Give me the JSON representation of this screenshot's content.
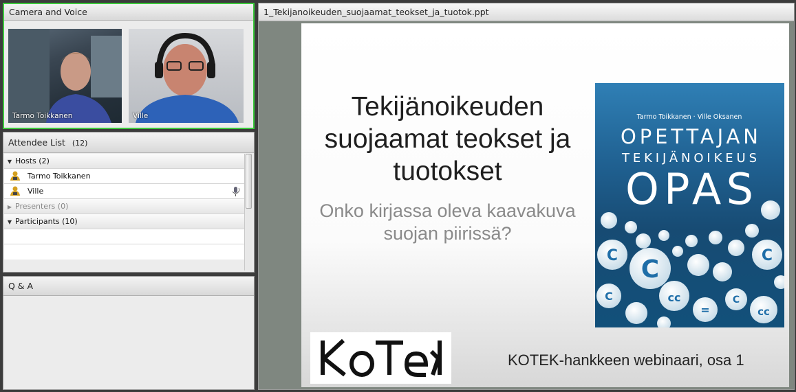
{
  "camera_pod": {
    "title": "Camera and Voice",
    "videos": [
      {
        "name": "Tarmo Toikkanen"
      },
      {
        "name": "Ville"
      }
    ]
  },
  "attendee_pod": {
    "title": "Attendee List",
    "count": "(12)",
    "hosts_group": "Hosts (2)",
    "hosts": [
      "Tarmo Toikkanen",
      "Ville"
    ],
    "presenters_group": "Presenters (0)",
    "participants_group": "Participants (10)"
  },
  "qa_pod": {
    "title": "Q & A"
  },
  "share_pod": {
    "filename": "1_Tekijanoikeuden_suojaamat_teokset_ja_tuotok.ppt",
    "slide": {
      "title_lines": [
        "Tekijänoikeuden",
        "suojaamat teokset ja",
        "tuotokset"
      ],
      "subtitle_lines": [
        "Onko kirjassa oleva kaavakuva",
        "suojan piirissä?"
      ],
      "book": {
        "authors": "Tarmo Toikkanen · Ville Oksanen",
        "line1": "OPETTAJAN",
        "line2": "TEKIJÄNOIKEUS",
        "line3": "OPAS"
      },
      "logo_text": "KoTeK",
      "footer": "KOTEK-hankkeen webinaari, osa 1"
    }
  },
  "colors": {
    "camera_border": "#3cc83c",
    "book_blue": "#1f5f8f",
    "presentation_bg": "#7f8780"
  }
}
